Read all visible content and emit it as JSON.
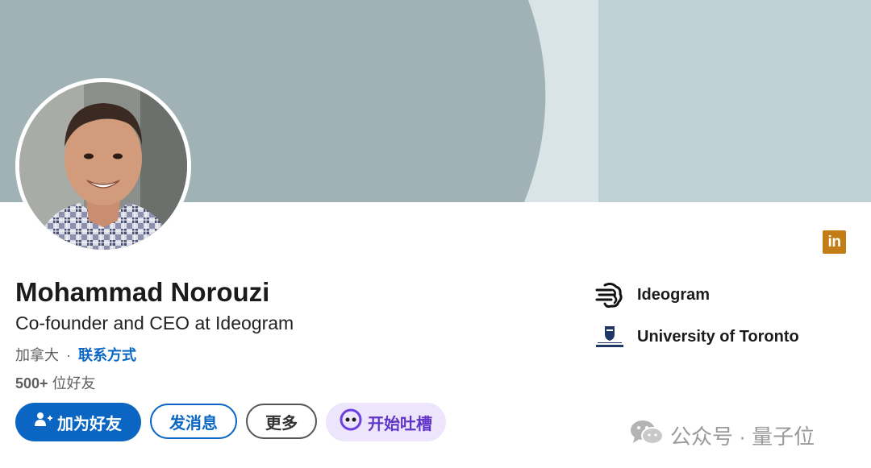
{
  "profile": {
    "name": "Mohammad Norouzi",
    "headline": "Co-founder and CEO at Ideogram",
    "location": "加拿大",
    "separator": "·",
    "contact_info": "联系方式",
    "connections_count": "500+",
    "connections_label": "位好友"
  },
  "actions": {
    "connect": "加为好友",
    "message": "发消息",
    "more": "更多",
    "ai": "开始吐槽"
  },
  "badge": {
    "linkedin": "in"
  },
  "organizations": [
    {
      "name": "Ideogram",
      "icon": "ideogram-logo"
    },
    {
      "name": "University of Toronto",
      "icon": "university-of-toronto-crest"
    }
  ],
  "watermark": {
    "text": "公众号 · 量子位",
    "icon": "wechat-icon"
  },
  "colors": {
    "banner_left": "#a0b2b5",
    "banner_band": "#d8e4e6",
    "banner_right": "#bed2d6",
    "primary": "#0a66c2",
    "linkedin_badge": "#c37d16",
    "ai_button_bg": "#ece5fb",
    "ai_button_text": "#5f34c6"
  }
}
